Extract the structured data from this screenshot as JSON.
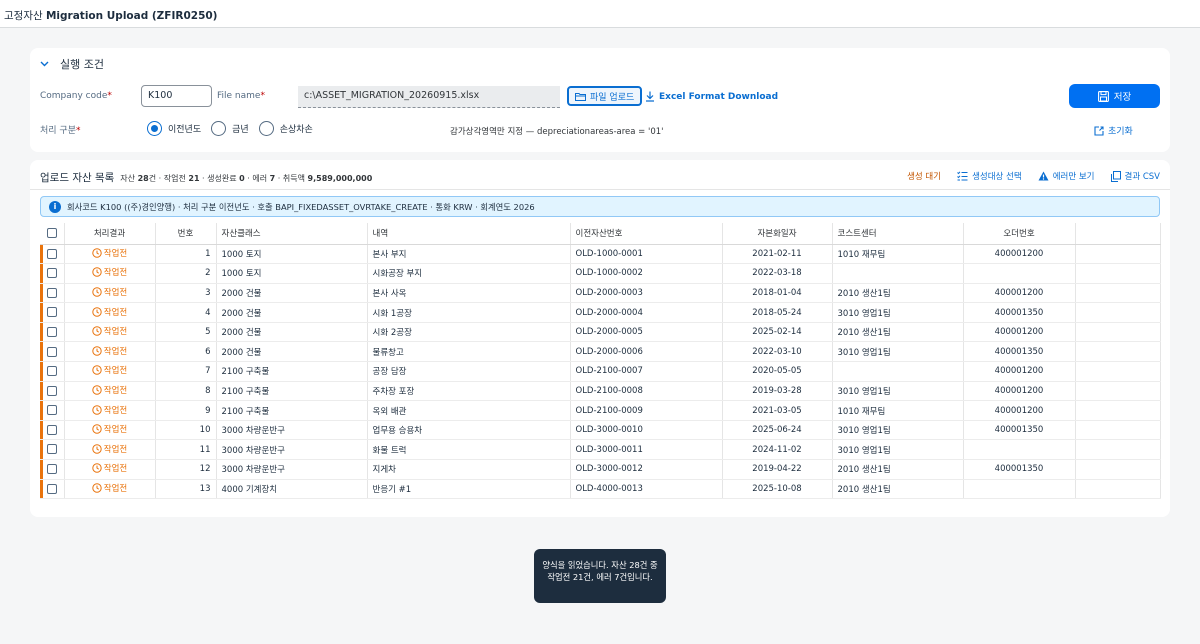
{
  "app": {
    "title_prefix": "고정자산",
    "title_main": "Migration Upload (ZFIR0250)"
  },
  "conditions": {
    "title": "실행 조건",
    "company_code_label": "Company code",
    "company_code_value": "K100",
    "file_name_label": "File name",
    "file_name_value": "c:\\ASSET_MIGRATION_20260915.xlsx",
    "file_upload_label": "파일 업로드",
    "excel_download_label": "Excel Format Download",
    "save_label": "저장",
    "processing_label": "처리 구분",
    "radio_options": [
      "이전년도",
      "금년",
      "손상차손"
    ],
    "selected_option": "이전년도",
    "area_note": "감가상각영역만 지정 — depreciationareas-area = '01'",
    "reset_label": "초기화"
  },
  "list": {
    "title": "업로드 자산 목록",
    "stats": {
      "asset_label": "자산",
      "asset_count": "28",
      "asset_unit": "건",
      "todo_label": "작업전",
      "todo_count": "21",
      "done_label": "생성완료",
      "done_count": "0",
      "error_label": "에러",
      "error_count": "7",
      "amount_label": "취득액",
      "amount": "9,589,000,000"
    },
    "toolbar": {
      "pending": "생성 대기",
      "select": "생성대상 선택",
      "errors_only": "에러만 보기",
      "csv": "결과 CSV"
    },
    "info": "회사코드 K100 ((주)경인양행) · 처리 구분 이전년도 · 호출 BAPI_FIXEDASSET_OVRTAKE_CREATE · 통화 KRW · 회계연도 2026",
    "columns": {
      "result": "처리결과",
      "no": "번호",
      "class": "자산클래스",
      "desc": "내역",
      "old_no": "이전자산번호",
      "cap_date": "자본화일자",
      "cost_center": "코스트센터",
      "order_no": "오더번호"
    },
    "rows": [
      {
        "status": "작업전",
        "no": "1",
        "class": "1000 토지",
        "desc": "본사 부지",
        "old_no": "OLD-1000-0001",
        "cap_date": "2021-02-11",
        "cost_center": "1010 재무팀",
        "order_no": "400001200"
      },
      {
        "status": "작업전",
        "no": "2",
        "class": "1000 토지",
        "desc": "시화공장 부지",
        "old_no": "OLD-1000-0002",
        "cap_date": "2022-03-18",
        "cost_center": "",
        "order_no": ""
      },
      {
        "status": "작업전",
        "no": "3",
        "class": "2000 건물",
        "desc": "본사 사옥",
        "old_no": "OLD-2000-0003",
        "cap_date": "2018-01-04",
        "cost_center": "2010 생산1팀",
        "order_no": "400001200"
      },
      {
        "status": "작업전",
        "no": "4",
        "class": "2000 건물",
        "desc": "시화 1공장",
        "old_no": "OLD-2000-0004",
        "cap_date": "2018-05-24",
        "cost_center": "3010 영업1팀",
        "order_no": "400001350"
      },
      {
        "status": "작업전",
        "no": "5",
        "class": "2000 건물",
        "desc": "시화 2공장",
        "old_no": "OLD-2000-0005",
        "cap_date": "2025-02-14",
        "cost_center": "2010 생산1팀",
        "order_no": "400001200"
      },
      {
        "status": "작업전",
        "no": "6",
        "class": "2000 건물",
        "desc": "물류창고",
        "old_no": "OLD-2000-0006",
        "cap_date": "2022-03-10",
        "cost_center": "3010 영업1팀",
        "order_no": "400001350"
      },
      {
        "status": "작업전",
        "no": "7",
        "class": "2100 구축물",
        "desc": "공장 담장",
        "old_no": "OLD-2100-0007",
        "cap_date": "2020-05-05",
        "cost_center": "",
        "order_no": "400001200"
      },
      {
        "status": "작업전",
        "no": "8",
        "class": "2100 구축물",
        "desc": "주차장 포장",
        "old_no": "OLD-2100-0008",
        "cap_date": "2019-03-28",
        "cost_center": "3010 영업1팀",
        "order_no": "400001200"
      },
      {
        "status": "작업전",
        "no": "9",
        "class": "2100 구축물",
        "desc": "옥외 배관",
        "old_no": "OLD-2100-0009",
        "cap_date": "2021-03-05",
        "cost_center": "1010 재무팀",
        "order_no": "400001200"
      },
      {
        "status": "작업전",
        "no": "10",
        "class": "3000 차량운반구",
        "desc": "업무용 승용차",
        "old_no": "OLD-3000-0010",
        "cap_date": "2025-06-24",
        "cost_center": "3010 영업1팀",
        "order_no": "400001350"
      },
      {
        "status": "작업전",
        "no": "11",
        "class": "3000 차량운반구",
        "desc": "화물 트럭",
        "old_no": "OLD-3000-0011",
        "cap_date": "2024-11-02",
        "cost_center": "3010 영업1팀",
        "order_no": ""
      },
      {
        "status": "작업전",
        "no": "12",
        "class": "3000 차량운반구",
        "desc": "지게차",
        "old_no": "OLD-3000-0012",
        "cap_date": "2019-04-22",
        "cost_center": "2010 생산1팀",
        "order_no": "400001350"
      },
      {
        "status": "작업전",
        "no": "13",
        "class": "4000 기계장치",
        "desc": "반응기 #1",
        "old_no": "OLD-4000-0013",
        "cap_date": "2025-10-08",
        "cost_center": "2010 생산1팀",
        "order_no": ""
      }
    ]
  },
  "toast": {
    "message": "양식을 읽었습니다. 자산 28건 중 작업전 21건, 에러 7건입니다."
  },
  "colors": {
    "accent": "#0a6ed1",
    "primary_button": "#0070f2",
    "warning": "#e9730c",
    "info_bg": "#e1f4ff"
  }
}
